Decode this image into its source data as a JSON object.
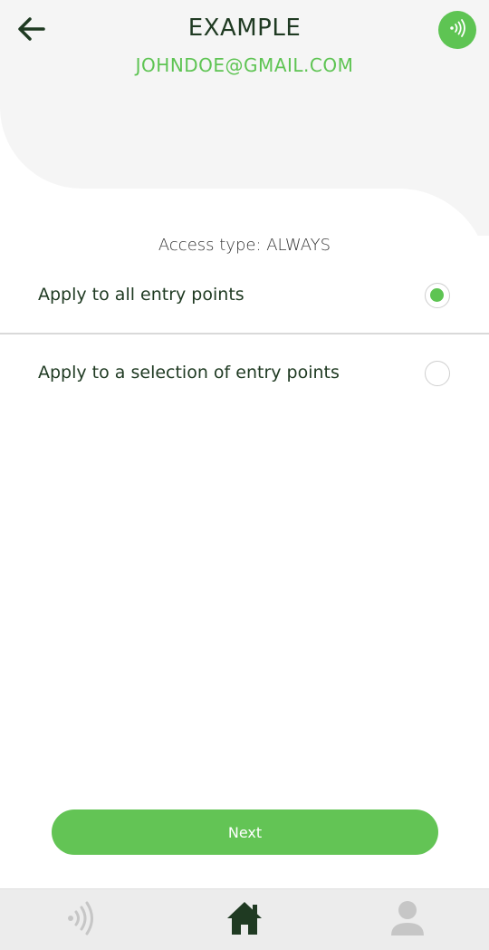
{
  "header": {
    "title": "EXAMPLE",
    "email": "JOHNDOE@GMAIL.COM",
    "back_icon": "arrow-left-icon",
    "nfc_icon": "nfc-icon"
  },
  "main": {
    "access_type": "Access type: ALWAYS",
    "options": [
      {
        "label": "Apply to all entry points",
        "selected": true
      },
      {
        "label": "Apply to a selection of entry points",
        "selected": false
      }
    ],
    "next_label": "Next"
  },
  "bottom_nav": {
    "items": [
      {
        "name": "nfc",
        "icon": "nfc-icon",
        "active": false
      },
      {
        "name": "home",
        "icon": "home-icon",
        "active": true
      },
      {
        "name": "profile",
        "icon": "user-icon",
        "active": false
      }
    ]
  },
  "colors": {
    "accent": "#5ec453",
    "dark_green": "#1f3a22",
    "nav_inactive": "#c6c6c6"
  }
}
